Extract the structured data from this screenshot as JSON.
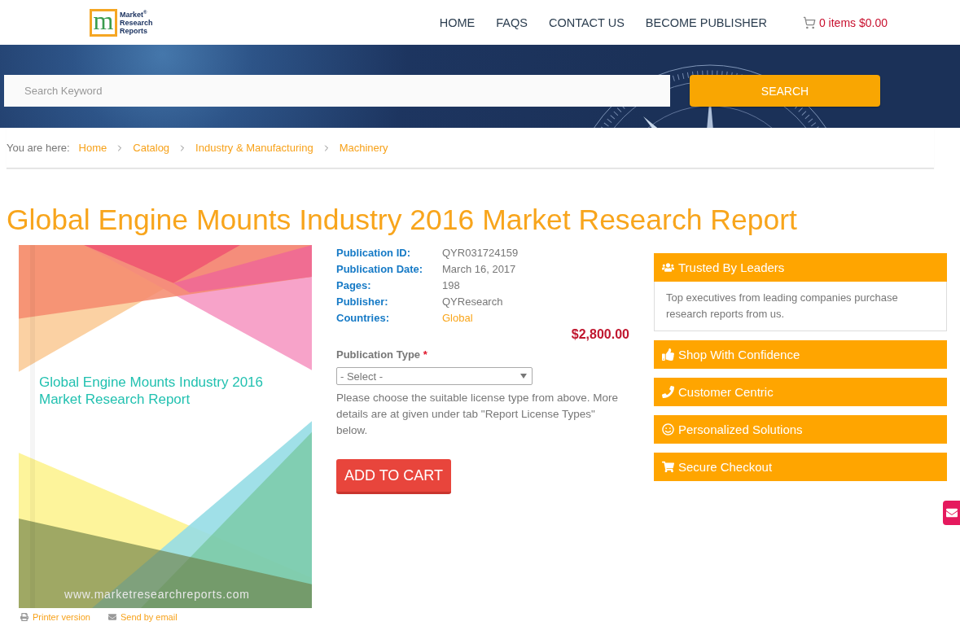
{
  "header": {
    "logo": {
      "letter": "m",
      "lines": [
        "Market",
        "Research",
        "Reports"
      ],
      "mark": "®"
    },
    "nav": [
      {
        "label": "HOME"
      },
      {
        "label": "FAQS"
      },
      {
        "label": "CONTACT US"
      },
      {
        "label": "BECOME PUBLISHER"
      }
    ],
    "cart": {
      "label": "0 items $0.00"
    }
  },
  "banner": {
    "search": {
      "placeholder": "Search Keyword"
    },
    "button": "SEARCH"
  },
  "breadcrumb": {
    "prefix": "You are here:",
    "items": [
      "Home",
      "Catalog",
      "Industry & Manufacturing",
      "Machinery"
    ]
  },
  "title": "Global Engine Mounts Industry 2016 Market Research Report",
  "cover": {
    "title": "Global Engine Mounts Industry 2016 Market Research Report",
    "url": "www.marketresearchreports.com"
  },
  "links": [
    {
      "label": "Printer version"
    },
    {
      "label": "Send by email"
    }
  ],
  "details": [
    {
      "label": "Publication ID:",
      "value": "QYR031724159",
      "kind": "text"
    },
    {
      "label": "Publication Date:",
      "value": "March 16, 2017",
      "kind": "text"
    },
    {
      "label": "Pages:",
      "value": "198",
      "kind": "text"
    },
    {
      "label": "Publisher:",
      "value": "QYResearch",
      "kind": "text"
    },
    {
      "label": "Countries:",
      "value": "Global",
      "kind": "link"
    }
  ],
  "price": "$2,800.00",
  "publication_type": {
    "label": "Publication Type",
    "required_mark": "*",
    "select": {
      "value": "- Select -"
    },
    "help": "Please choose the suitable license type from above. More details are at given under tab \"Report License Types\" below."
  },
  "add_to_cart": "ADD TO CART",
  "sidebar": [
    {
      "title": "Trusted By Leaders",
      "body": "Top executives from leading companies purchase research reports from us."
    },
    {
      "title": "Shop With Confidence"
    },
    {
      "title": "Customer Centric"
    },
    {
      "title": "Personalized Solutions"
    },
    {
      "title": "Secure Checkout"
    }
  ]
}
